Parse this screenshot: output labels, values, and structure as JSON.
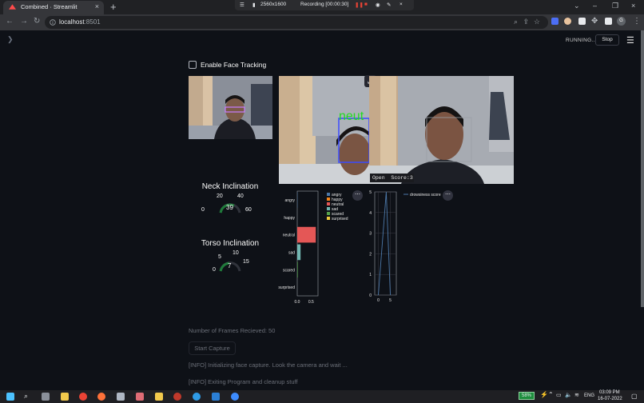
{
  "browser": {
    "tab_title": "Combined · Streamlit",
    "url_host": "localhost",
    "url_port": ":8501",
    "recording": {
      "resolution": "2560x1600",
      "status": "Recording [00:00:30]"
    }
  },
  "app": {
    "status": "RUNNING...",
    "stop_label": "Stop",
    "checkbox_label": "Enable Face Tracking",
    "neck": {
      "title": "Neck Inclination",
      "value": "39",
      "ticks": [
        "0",
        "20",
        "40",
        "60"
      ],
      "level": 39
    },
    "torso": {
      "title": "Torso Inclination",
      "value": "7",
      "ticks": [
        "0",
        "5",
        "10",
        "15"
      ],
      "level": 7
    },
    "overlay_text": "neut",
    "eye_state": "Open",
    "eye_score": "Score:3",
    "frames_text": "Number of Frames Recieved: 50",
    "start_capture": "Start Capture",
    "info1": "[INFO] Initializing face capture. Look the camera and wait ...",
    "info2": "[INFO] Exiting Program and cleanup stuff"
  },
  "chart_data": [
    {
      "type": "bar",
      "orientation": "horizontal",
      "categories": [
        "angry",
        "happy",
        "neutral",
        "sad",
        "scared",
        "surprised"
      ],
      "values": [
        0.01,
        0.0,
        0.67,
        0.12,
        0.02,
        0.0
      ],
      "xticks": [
        "0.0",
        "0.5"
      ],
      "xlim": [
        0,
        0.75
      ],
      "legend": [
        "angry",
        "happy",
        "neutral",
        "sad",
        "scared",
        "surprised"
      ],
      "colors": [
        "#4c78a8",
        "#f58518",
        "#e45756",
        "#72b7b2",
        "#54a24b",
        "#eeca3b"
      ]
    },
    {
      "type": "line",
      "series": [
        {
          "name": "drowsiness score",
          "x": [
            0,
            3.3,
            5
          ],
          "y": [
            0,
            5,
            0
          ]
        }
      ],
      "xticks": [
        "0",
        "5"
      ],
      "yticks": [
        "0",
        "1",
        "2",
        "3",
        "4",
        "5"
      ],
      "ylim": [
        0,
        5
      ],
      "xlim": [
        -1.5,
        7.5
      ]
    }
  ],
  "taskbar": {
    "battery": "58%",
    "lang": "ENG",
    "time": "03:09 PM",
    "date": "16-07-2022"
  }
}
